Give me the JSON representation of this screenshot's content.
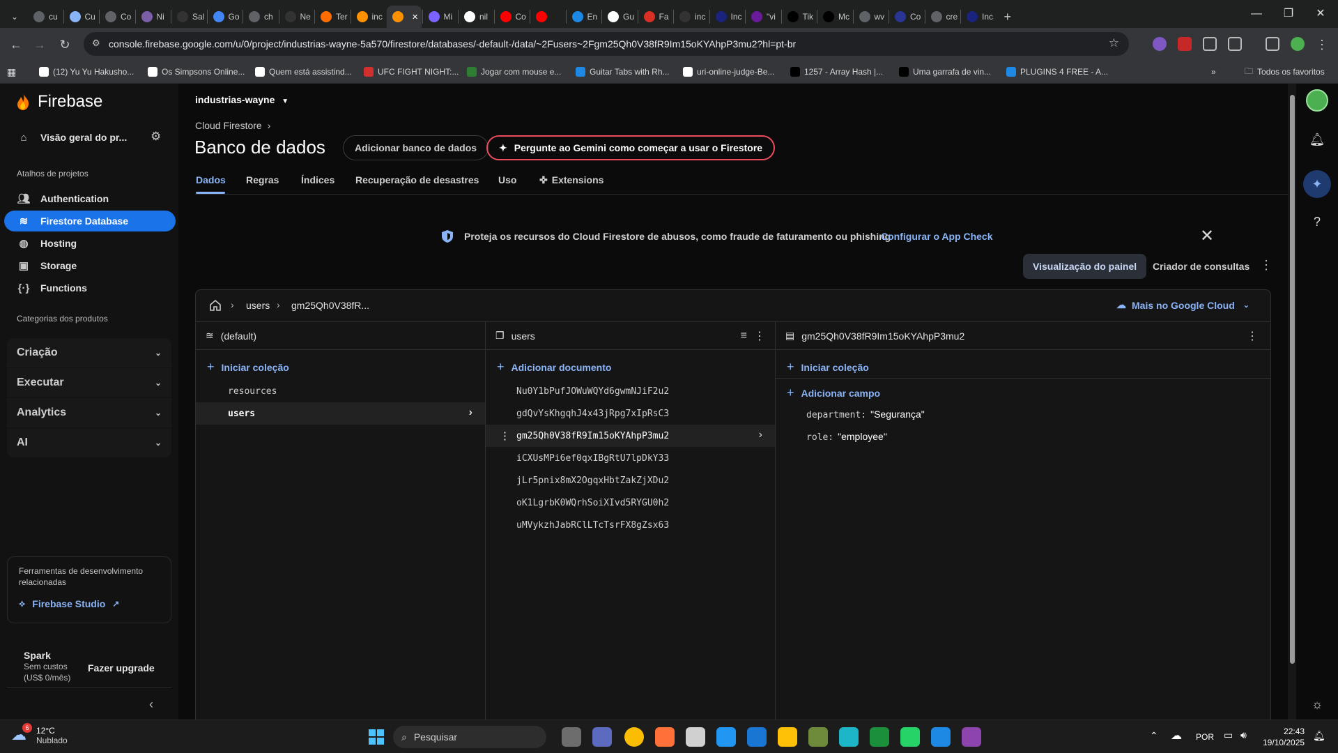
{
  "browser": {
    "tabs": [
      {
        "label": "cu",
        "color": "#5f6368"
      },
      {
        "label": "Cu",
        "color": "#8ab4f8"
      },
      {
        "label": "Co",
        "color": "#5f6368"
      },
      {
        "label": "Ni",
        "color": "#7b5ea7"
      },
      {
        "label": "Sal",
        "color": "#333333"
      },
      {
        "label": "Go",
        "color": "#4285f4"
      },
      {
        "label": "ch",
        "color": "#5f6368"
      },
      {
        "label": "Ne",
        "color": "#333333"
      },
      {
        "label": "Ter",
        "color": "#ff6d00"
      },
      {
        "label": "inc",
        "color": "#ff9100"
      },
      {
        "label": "",
        "color": "#ff9100",
        "active": true
      },
      {
        "label": "Mi",
        "color": "#7b61ff"
      },
      {
        "label": "nil",
        "color": "#ffffff"
      },
      {
        "label": "Co",
        "color": "#ff0000"
      },
      {
        "label": "",
        "color": "#ff0000"
      },
      {
        "label": "En",
        "color": "#1e88e5"
      },
      {
        "label": "Gu",
        "color": "#ffffff"
      },
      {
        "label": "Fa",
        "color": "#d93025"
      },
      {
        "label": "inc",
        "color": "#333333"
      },
      {
        "label": "Inc",
        "color": "#1a237e"
      },
      {
        "label": "\"vi",
        "color": "#6a1b9a"
      },
      {
        "label": "Tik",
        "color": "#000000"
      },
      {
        "label": "Mc",
        "color": "#000000"
      },
      {
        "label": "wv",
        "color": "#5f6368"
      },
      {
        "label": "Co",
        "color": "#283593"
      },
      {
        "label": "cre",
        "color": "#5f6368"
      },
      {
        "label": "Inc",
        "color": "#1a237e"
      }
    ],
    "url": "console.firebase.google.com/u/0/project/industrias-wayne-5a570/firestore/databases/-default-/data/~2Fusers~2Fgm25Qh0V38fR9Im15oKYAhpP3mu2?hl=pt-br",
    "bookmarks": [
      {
        "label": "(12) Yu Yu Hakusho...",
        "color": "#ffffff"
      },
      {
        "label": "Os Simpsons Online...",
        "color": "#ffffff"
      },
      {
        "label": "Quem está assistind...",
        "color": "#ffffff"
      },
      {
        "label": "UFC FIGHT NIGHT:...",
        "color": "#d32f2f"
      },
      {
        "label": "Jogar com mouse e...",
        "color": "#2e7d32"
      },
      {
        "label": "Guitar Tabs with Rh...",
        "color": "#1e88e5"
      },
      {
        "label": "uri-online-judge-Be...",
        "color": "#ffffff"
      },
      {
        "label": "1257 - Array Hash |...",
        "color": "#000000"
      },
      {
        "label": "Uma garrafa de vin...",
        "color": "#000000"
      },
      {
        "label": "PLUGINS 4 FREE - A...",
        "color": "#1e88e5"
      }
    ],
    "all_bookmarks": "Todos os favoritos"
  },
  "sidebar": {
    "brand": "Firebase",
    "overview": "Visão geral do pr...",
    "shortcuts_title": "Atalhos de projetos",
    "items": [
      {
        "label": "Authentication",
        "icon": "people-icon"
      },
      {
        "label": "Firestore Database",
        "icon": "firestore-icon",
        "active": true
      },
      {
        "label": "Hosting",
        "icon": "globe-icon"
      },
      {
        "label": "Storage",
        "icon": "image-icon"
      },
      {
        "label": "Functions",
        "icon": "functions-icon"
      }
    ],
    "categories_title": "Categorias dos produtos",
    "categories": [
      "Criação",
      "Executar",
      "Analytics",
      "AI"
    ],
    "tools_desc": "Ferramentas de desenvolvimento relacionadas",
    "studio_label": "Firebase Studio",
    "plan_name": "Spark",
    "plan_cost": "Sem custos",
    "plan_price": "(US$ 0/mês)",
    "upgrade": "Fazer upgrade"
  },
  "header": {
    "project": "industrias-wayne",
    "breadcrumb": "Cloud Firestore",
    "title": "Banco de dados",
    "add_db": "Adicionar banco de dados",
    "gemini": "Pergunte ao Gemini como começar a usar o Firestore",
    "tabs": [
      "Dados",
      "Regras",
      "Índices",
      "Recuperação de desastres",
      "Uso",
      "Extensions"
    ]
  },
  "banner": {
    "text": "Proteja os recursos do Cloud Firestore de abusos, como fraude de faturamento ou phishing",
    "link": "Configurar o App Check"
  },
  "view": {
    "panel": "Visualização do painel",
    "query": "Criador de consultas"
  },
  "path": {
    "parts": [
      "users",
      "gm25Qh0V38fR..."
    ],
    "gcloud": "Mais no Google Cloud"
  },
  "col1": {
    "title": "(default)",
    "add": "Iniciar coleção",
    "items": [
      "resources",
      "users"
    ],
    "selected": 1
  },
  "col2": {
    "title": "users",
    "add": "Adicionar documento",
    "items": [
      "Nu0Y1bPufJOWuWQYd6gwmNJiF2u2",
      "gdQvYsKhgqhJ4x43jRpg7xIpRsC3",
      "gm25Qh0V38fR9Im15oKYAhpP3mu2",
      "iCXUsMPi6ef0qxIBgRtU7lpDkY33",
      "jLr5pnix8mX2OgqxHbtZakZjXDu2",
      "oK1LgrbK0WQrhSoiXIvd5RYGU0h2",
      "uMVykzhJabRClLTcTsrFX8gZsx63"
    ],
    "selected": 2
  },
  "col3": {
    "title": "gm25Qh0V38fR9Im15oKYAhpP3mu2",
    "add_collection": "Iniciar coleção",
    "add_field": "Adicionar campo",
    "fields": [
      {
        "key": "department:",
        "value": "\"Segurança\""
      },
      {
        "key": "role:",
        "value": "\"employee\""
      }
    ]
  },
  "taskbar": {
    "temp": "12°C",
    "weather": "Nublado",
    "weather_badge": "6",
    "search": "Pesquisar",
    "lang": "POR",
    "time": "22:43",
    "date": "19/10/2025"
  },
  "colors": {
    "accent": "#8ab4f8",
    "active_nav": "#1a73e8",
    "gemini_border": "#ef4b5f"
  }
}
